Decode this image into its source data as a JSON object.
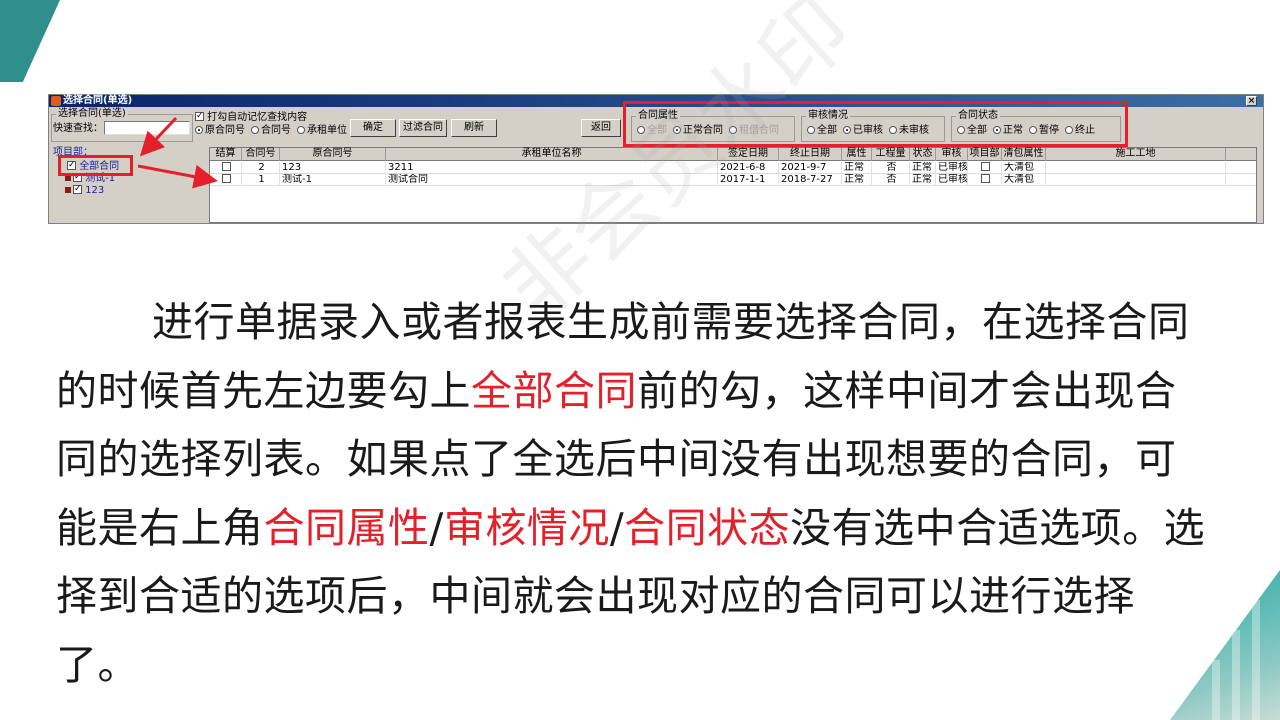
{
  "dialog": {
    "title": "选择合同(单选)",
    "close_glyph": "×",
    "select_group_label": "选择合同(单选)",
    "quick_search_label": "快速查找：",
    "quick_search_value": "",
    "remember_label": "打勾自动记忆查找内容",
    "search_modes": [
      "原合同号",
      "合同号",
      "承租单位"
    ],
    "buttons": {
      "confirm": "确定",
      "filter": "过滤合同",
      "refresh": "刷新",
      "back": "返回"
    },
    "attribute": {
      "label": "合同属性",
      "options": [
        "全部",
        "正常合同",
        "租借合同"
      ]
    },
    "review": {
      "label": "审核情况",
      "options": [
        "全部",
        "已审核",
        "未审核"
      ]
    },
    "status": {
      "label": "合同状态",
      "options": [
        "全部",
        "正常",
        "暂停",
        "终止"
      ]
    },
    "tree": {
      "header": "项目部：",
      "items": [
        "全部合同",
        "测试-1",
        "123"
      ]
    },
    "grid": {
      "columns": [
        "结算",
        "合同号",
        "原合同号",
        "承租单位名称",
        "签定日期",
        "终止日期",
        "属性",
        "工程量",
        "状态",
        "审核",
        "项目部",
        "清包属性",
        "施工工地"
      ],
      "rows": [
        [
          "",
          "2",
          "123",
          "3211",
          "2021-6-8",
          "2021-9-7",
          "正常",
          "否",
          "正常",
          "已审核",
          "",
          "大清包",
          ""
        ],
        [
          "",
          "1",
          "测试-1",
          "测试合同",
          "2017-1-1",
          "2018-7-27",
          "正常",
          "否",
          "正常",
          "已审核",
          "",
          "大清包",
          ""
        ]
      ]
    }
  },
  "watermark": "非会员水印",
  "paragraph": {
    "p1": "进行单据录入或者报表生成前需要选择合同，在选择合同的时候首先左边要勾上",
    "h1": "全部合同",
    "p2": "前的勾，这样中间才会出现合同的选择列表。如果点了全选后中间没有出现想要的合同，可能是右上角",
    "h2": "合同属性",
    "s1": "/",
    "h3": "审核情况",
    "s2": "/",
    "h4": "合同状态",
    "p3": "没有选中合适选项。选择到合适的选项后，中间就会出现对应的合同可以进行选择了。"
  }
}
